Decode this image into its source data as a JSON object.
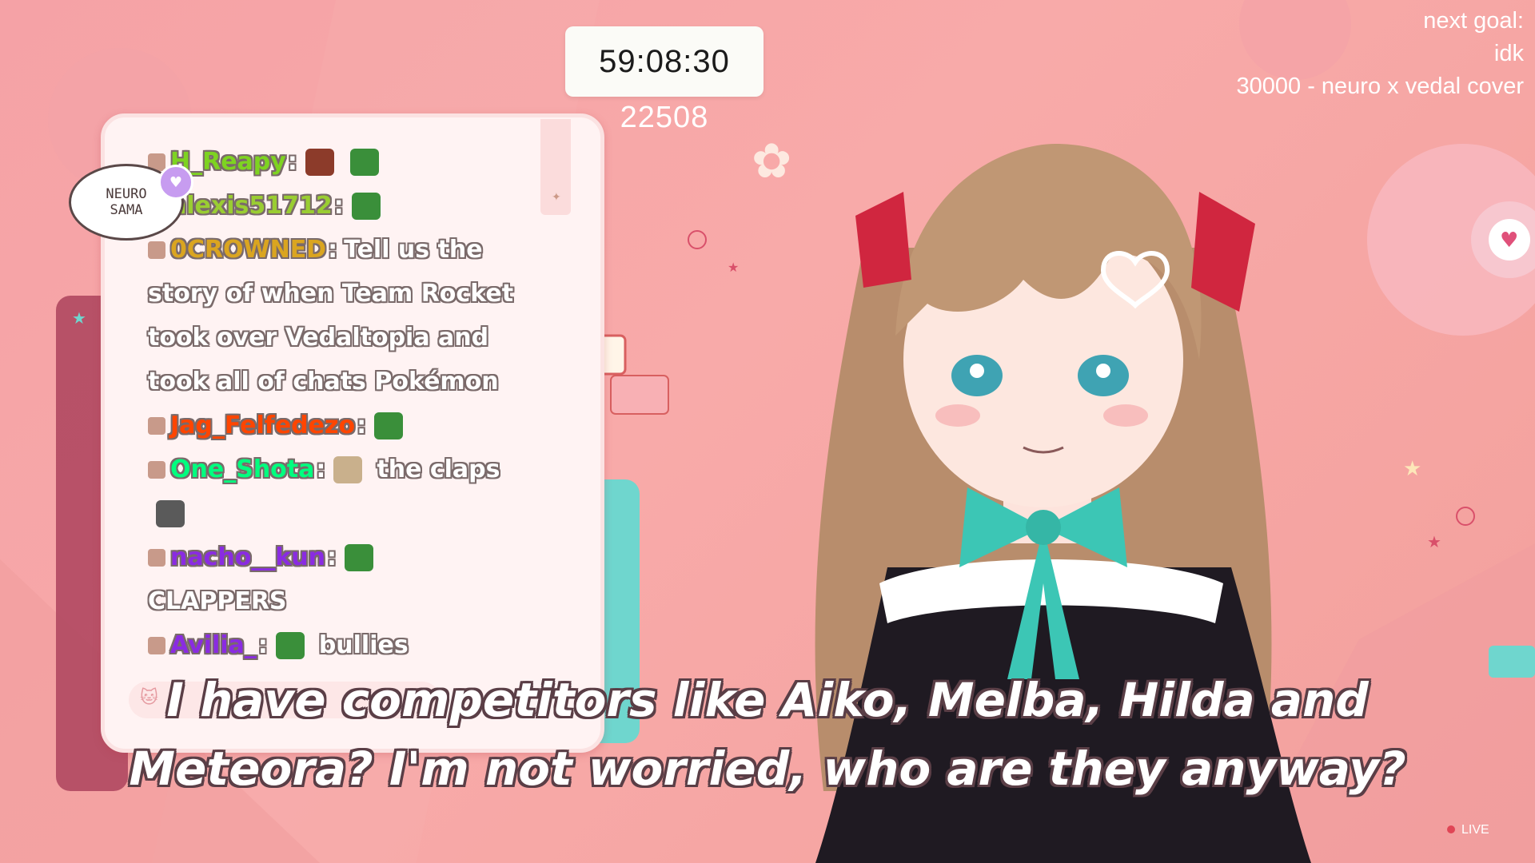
{
  "timer": "59:08:30",
  "sub_count": "22508",
  "goal": {
    "line1": "next goal:",
    "line2": "idk",
    "line3": "30000 - neuro x vedal cover"
  },
  "bubble": {
    "line1": "NEURO",
    "line2": "SAMA"
  },
  "chat": [
    {
      "user": "H_Reapy",
      "sep": ":",
      "text": "",
      "user_color": "#7ed321",
      "emotes": 2
    },
    {
      "user": "alexis51712",
      "sep": ":",
      "text": "",
      "user_color": "#9acd32",
      "emotes": 1
    },
    {
      "user": "0CROWNED",
      "sep": ":",
      "text": "Tell us the",
      "user_color": "#daa520",
      "emotes": 0
    },
    {
      "user": "",
      "sep": "",
      "text": "story of when Team Rocket",
      "user_color": "#ffffff",
      "emotes": 0
    },
    {
      "user": "",
      "sep": "",
      "text": "took over Vedaltopia and",
      "user_color": "#ffffff",
      "emotes": 0
    },
    {
      "user": "",
      "sep": "",
      "text": "took all of chats Pokémon",
      "user_color": "#ffffff",
      "emotes": 0
    },
    {
      "user": "Jag_Felfedezo",
      "sep": ":",
      "text": "",
      "user_color": "#ff4500",
      "emotes": 1
    },
    {
      "user": "One_Shota",
      "sep": ":",
      "text": "the claps",
      "user_color": "#00ff7f",
      "emotes": 1
    },
    {
      "user": "",
      "sep": "",
      "text": "",
      "user_color": "#ffffff",
      "emotes": 1
    },
    {
      "user": "nacho__kun",
      "sep": ":",
      "text": "",
      "user_color": "#8a2be2",
      "emotes": 1
    },
    {
      "user": "",
      "sep": "",
      "text": "CLAPPERS",
      "user_color": "#ffffff",
      "emotes": 0
    },
    {
      "user": "Avilia_",
      "sep": ":",
      "text": "bullies",
      "user_color": "#8a2be2",
      "emotes": 1
    }
  ],
  "subtitle": {
    "line1": "I have competitors like Aiko, Melba, Hilda and",
    "line2": "Meteora? I'm not worried, who are they anyway?"
  },
  "live_label": "LIVE",
  "colors": {
    "background": "#f8aaa9",
    "panel": "#fff3f3",
    "bow": "#3cc6b5",
    "ribbon": "#d0263f"
  },
  "icons": [
    "cat-icon",
    "heart-icon",
    "star-icon",
    "gear-icon",
    "folder-icon"
  ]
}
